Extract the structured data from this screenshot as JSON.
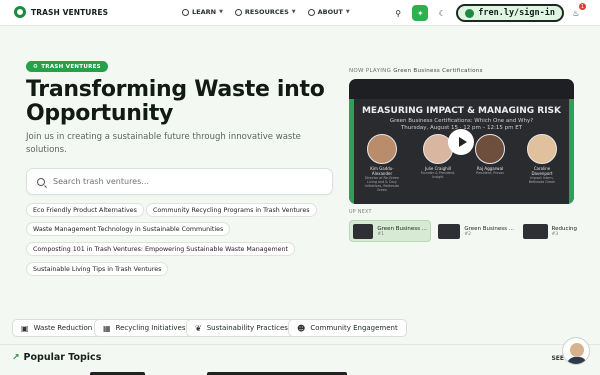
{
  "header": {
    "brand": "TRASH VENTURES",
    "nav": [
      {
        "label": "LEARN"
      },
      {
        "label": "RESOURCES"
      },
      {
        "label": "ABOUT"
      }
    ],
    "signin_label": "fren.ly/sign-in",
    "notification_count": "1"
  },
  "hero": {
    "badge": "TRASH VENTURES",
    "title": "Transforming Waste into Opportunity",
    "subtitle": "Join us in creating a sustainable future through innovative waste solutions."
  },
  "search": {
    "placeholder": "Search trash ventures..."
  },
  "suggestions": [
    "Eco Friendly Product Alternatives",
    "Community Recycling Programs in Trash Ventures",
    "Waste Management Technology in Sustainable Communities",
    "Composting 101 in Trash Ventures: Empowering Sustainable Waste Management",
    "Sustainable Living Tips in Trash Ventures"
  ],
  "player": {
    "now_playing_label": "NOW PLAYING",
    "now_playing_title": "Green Business Certifications",
    "video_title": "MEASURING IMPACT & MANAGING RISK",
    "video_subtitle": "Green Business Certifications: Which One and Why?",
    "video_date": "Thursday, August 15 · 12 pm – 12:15 pm ET",
    "speakers": [
      {
        "name": "Kim Gaddu-Alexander",
        "role": "Director of Re-Green Living and & Cosy Initiatives, Bethesda Green"
      },
      {
        "name": "Julie Craighill",
        "role": "Founder & President, Insight"
      },
      {
        "name": "Raj Aggarwal",
        "role": "President, Provoc"
      },
      {
        "name": "Caroline Davenport",
        "role": "Impact Intern, Bethesda Green"
      }
    ],
    "up_next_label": "UP NEXT",
    "up_next": [
      {
        "title": "Green Business ...",
        "num": "#1"
      },
      {
        "title": "Green Business ...",
        "num": "#2"
      },
      {
        "title": "Reducing",
        "num": "#3"
      }
    ]
  },
  "categories": [
    {
      "label": "Waste Reduction",
      "icon": "briefcase-icon"
    },
    {
      "label": "Recycling Initiatives",
      "icon": "building-icon"
    },
    {
      "label": "Sustainability Practices",
      "icon": "leaf-icon"
    },
    {
      "label": "Community Engagement",
      "icon": "people-icon"
    }
  ],
  "popular": {
    "title": "Popular Topics",
    "see_all": "SEE"
  },
  "colors": {
    "brand_green": "#25a147",
    "background": "#f4f8f3"
  }
}
